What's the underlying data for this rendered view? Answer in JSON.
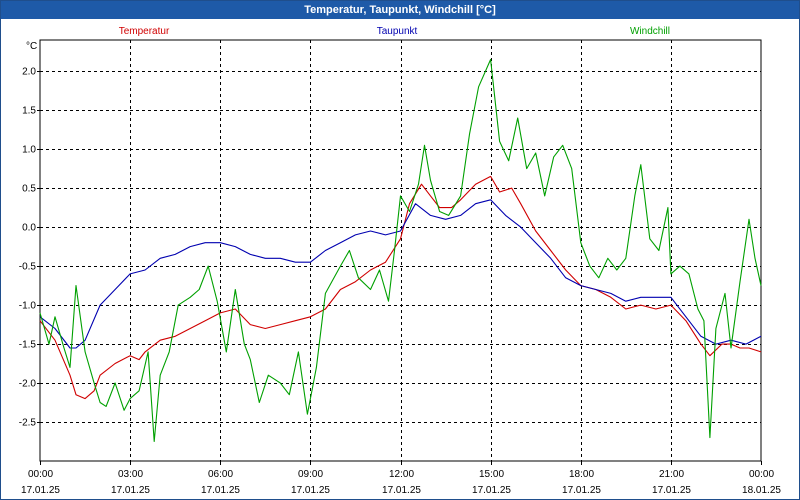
{
  "window": {
    "title": "Temperatur, Taupunkt, Windchill [°C]"
  },
  "chart_data": {
    "type": "line",
    "title": "Temperatur, Taupunkt, Windchill [°C]",
    "ylabel": "°C",
    "ylim": [
      -3.0,
      2.4
    ],
    "yticks": [
      2.0,
      1.5,
      1.0,
      0.5,
      0.0,
      -0.5,
      -1.0,
      -1.5,
      -2.0,
      -2.5
    ],
    "ytick_labels": [
      "2.0",
      "1.5",
      "1.0",
      "0.5",
      "0.0",
      "-0.5",
      "-1.0",
      "-1.5",
      "-2.0",
      "-2.5"
    ],
    "xlim": [
      0,
      24
    ],
    "x_unit": "hours from 17.01.25 00:00",
    "xticks": [
      {
        "t": 0,
        "time": "00:00",
        "date": "17.01.25"
      },
      {
        "t": 3,
        "time": "03:00",
        "date": "17.01.25"
      },
      {
        "t": 6,
        "time": "06:00",
        "date": "17.01.25"
      },
      {
        "t": 9,
        "time": "09:00",
        "date": "17.01.25"
      },
      {
        "t": 12,
        "time": "12:00",
        "date": "17.01.25"
      },
      {
        "t": 15,
        "time": "15:00",
        "date": "17.01.25"
      },
      {
        "t": 18,
        "time": "18:00",
        "date": "17.01.25"
      },
      {
        "t": 21,
        "time": "21:00",
        "date": "17.01.25"
      },
      {
        "t": 24,
        "time": "00:00",
        "date": "18.01.25"
      }
    ],
    "grid": true,
    "legend_position": "top",
    "series": [
      {
        "name": "Temperatur",
        "color": "#d00000",
        "points": [
          [
            0.0,
            -1.2
          ],
          [
            0.5,
            -1.45
          ],
          [
            1.0,
            -1.9
          ],
          [
            1.2,
            -2.15
          ],
          [
            1.5,
            -2.2
          ],
          [
            1.8,
            -2.1
          ],
          [
            2.0,
            -1.9
          ],
          [
            2.5,
            -1.75
          ],
          [
            3.0,
            -1.65
          ],
          [
            3.3,
            -1.7
          ],
          [
            3.5,
            -1.6
          ],
          [
            4.0,
            -1.45
          ],
          [
            4.5,
            -1.4
          ],
          [
            5.0,
            -1.3
          ],
          [
            5.5,
            -1.2
          ],
          [
            6.0,
            -1.1
          ],
          [
            6.5,
            -1.05
          ],
          [
            7.0,
            -1.25
          ],
          [
            7.5,
            -1.3
          ],
          [
            8.0,
            -1.25
          ],
          [
            8.5,
            -1.2
          ],
          [
            9.0,
            -1.15
          ],
          [
            9.5,
            -1.05
          ],
          [
            10.0,
            -0.8
          ],
          [
            10.5,
            -0.7
          ],
          [
            11.0,
            -0.55
          ],
          [
            11.5,
            -0.45
          ],
          [
            12.0,
            -0.15
          ],
          [
            12.3,
            0.3
          ],
          [
            12.7,
            0.55
          ],
          [
            13.0,
            0.4
          ],
          [
            13.3,
            0.25
          ],
          [
            13.7,
            0.25
          ],
          [
            14.0,
            0.35
          ],
          [
            14.5,
            0.55
          ],
          [
            15.0,
            0.65
          ],
          [
            15.3,
            0.45
          ],
          [
            15.7,
            0.5
          ],
          [
            16.0,
            0.3
          ],
          [
            16.5,
            -0.05
          ],
          [
            17.0,
            -0.3
          ],
          [
            17.5,
            -0.55
          ],
          [
            18.0,
            -0.75
          ],
          [
            18.5,
            -0.8
          ],
          [
            19.0,
            -0.9
          ],
          [
            19.5,
            -1.05
          ],
          [
            20.0,
            -1.0
          ],
          [
            20.5,
            -1.05
          ],
          [
            21.0,
            -1.0
          ],
          [
            21.5,
            -1.2
          ],
          [
            22.0,
            -1.5
          ],
          [
            22.3,
            -1.65
          ],
          [
            22.7,
            -1.5
          ],
          [
            23.0,
            -1.5
          ],
          [
            23.3,
            -1.55
          ],
          [
            23.6,
            -1.55
          ],
          [
            24.0,
            -1.6
          ]
        ]
      },
      {
        "name": "Taupunkt",
        "color": "#0000b0",
        "points": [
          [
            0.0,
            -1.15
          ],
          [
            0.5,
            -1.3
          ],
          [
            1.0,
            -1.55
          ],
          [
            1.2,
            -1.55
          ],
          [
            1.5,
            -1.45
          ],
          [
            2.0,
            -1.0
          ],
          [
            2.5,
            -0.8
          ],
          [
            3.0,
            -0.6
          ],
          [
            3.5,
            -0.55
          ],
          [
            4.0,
            -0.4
          ],
          [
            4.5,
            -0.35
          ],
          [
            5.0,
            -0.25
          ],
          [
            5.5,
            -0.2
          ],
          [
            6.0,
            -0.2
          ],
          [
            6.5,
            -0.25
          ],
          [
            7.0,
            -0.35
          ],
          [
            7.5,
            -0.4
          ],
          [
            8.0,
            -0.4
          ],
          [
            8.5,
            -0.45
          ],
          [
            9.0,
            -0.45
          ],
          [
            9.5,
            -0.3
          ],
          [
            10.0,
            -0.2
          ],
          [
            10.5,
            -0.1
          ],
          [
            11.0,
            -0.05
          ],
          [
            11.5,
            -0.1
          ],
          [
            12.0,
            -0.05
          ],
          [
            12.5,
            0.3
          ],
          [
            13.0,
            0.15
          ],
          [
            13.5,
            0.1
          ],
          [
            14.0,
            0.15
          ],
          [
            14.5,
            0.3
          ],
          [
            15.0,
            0.35
          ],
          [
            15.5,
            0.15
          ],
          [
            16.0,
            0.0
          ],
          [
            16.5,
            -0.2
          ],
          [
            17.0,
            -0.4
          ],
          [
            17.5,
            -0.65
          ],
          [
            18.0,
            -0.75
          ],
          [
            18.5,
            -0.8
          ],
          [
            19.0,
            -0.85
          ],
          [
            19.5,
            -0.95
          ],
          [
            20.0,
            -0.9
          ],
          [
            20.5,
            -0.9
          ],
          [
            21.0,
            -0.9
          ],
          [
            21.5,
            -1.15
          ],
          [
            22.0,
            -1.4
          ],
          [
            22.5,
            -1.5
          ],
          [
            23.0,
            -1.45
          ],
          [
            23.5,
            -1.5
          ],
          [
            24.0,
            -1.4
          ]
        ]
      },
      {
        "name": "Windchill",
        "color": "#00a000",
        "points": [
          [
            0.0,
            -1.1
          ],
          [
            0.3,
            -1.5
          ],
          [
            0.5,
            -1.15
          ],
          [
            0.8,
            -1.55
          ],
          [
            1.0,
            -1.8
          ],
          [
            1.2,
            -0.75
          ],
          [
            1.5,
            -1.6
          ],
          [
            1.8,
            -2.0
          ],
          [
            2.0,
            -2.25
          ],
          [
            2.2,
            -2.3
          ],
          [
            2.5,
            -2.0
          ],
          [
            2.8,
            -2.35
          ],
          [
            3.0,
            -2.2
          ],
          [
            3.3,
            -2.1
          ],
          [
            3.6,
            -1.6
          ],
          [
            3.8,
            -2.75
          ],
          [
            4.0,
            -1.9
          ],
          [
            4.3,
            -1.6
          ],
          [
            4.6,
            -1.0
          ],
          [
            5.0,
            -0.9
          ],
          [
            5.3,
            -0.8
          ],
          [
            5.6,
            -0.5
          ],
          [
            5.9,
            -0.95
          ],
          [
            6.2,
            -1.6
          ],
          [
            6.5,
            -0.8
          ],
          [
            6.8,
            -1.5
          ],
          [
            7.0,
            -1.7
          ],
          [
            7.3,
            -2.25
          ],
          [
            7.6,
            -1.9
          ],
          [
            8.0,
            -2.0
          ],
          [
            8.3,
            -2.15
          ],
          [
            8.6,
            -1.6
          ],
          [
            8.9,
            -2.4
          ],
          [
            9.2,
            -1.8
          ],
          [
            9.5,
            -0.85
          ],
          [
            10.0,
            -0.5
          ],
          [
            10.3,
            -0.3
          ],
          [
            10.6,
            -0.65
          ],
          [
            11.0,
            -0.8
          ],
          [
            11.3,
            -0.55
          ],
          [
            11.6,
            -0.95
          ],
          [
            11.8,
            -0.3
          ],
          [
            12.0,
            0.4
          ],
          [
            12.3,
            0.2
          ],
          [
            12.6,
            0.55
          ],
          [
            12.8,
            1.05
          ],
          [
            13.0,
            0.6
          ],
          [
            13.3,
            0.2
          ],
          [
            13.6,
            0.15
          ],
          [
            14.0,
            0.4
          ],
          [
            14.3,
            1.2
          ],
          [
            14.6,
            1.8
          ],
          [
            15.0,
            2.15
          ],
          [
            15.3,
            1.1
          ],
          [
            15.6,
            0.85
          ],
          [
            15.9,
            1.4
          ],
          [
            16.2,
            0.75
          ],
          [
            16.5,
            0.95
          ],
          [
            16.8,
            0.4
          ],
          [
            17.1,
            0.9
          ],
          [
            17.4,
            1.05
          ],
          [
            17.7,
            0.75
          ],
          [
            18.0,
            -0.2
          ],
          [
            18.3,
            -0.5
          ],
          [
            18.6,
            -0.65
          ],
          [
            18.9,
            -0.4
          ],
          [
            19.2,
            -0.55
          ],
          [
            19.5,
            -0.4
          ],
          [
            19.8,
            0.4
          ],
          [
            20.0,
            0.8
          ],
          [
            20.3,
            -0.15
          ],
          [
            20.6,
            -0.3
          ],
          [
            20.9,
            0.25
          ],
          [
            21.0,
            -0.6
          ],
          [
            21.3,
            -0.5
          ],
          [
            21.6,
            -0.6
          ],
          [
            21.9,
            -1.05
          ],
          [
            22.1,
            -1.2
          ],
          [
            22.3,
            -2.7
          ],
          [
            22.5,
            -1.3
          ],
          [
            22.8,
            -0.85
          ],
          [
            23.0,
            -1.55
          ],
          [
            23.3,
            -0.7
          ],
          [
            23.6,
            0.1
          ],
          [
            23.8,
            -0.4
          ],
          [
            24.0,
            -0.75
          ]
        ]
      }
    ]
  }
}
